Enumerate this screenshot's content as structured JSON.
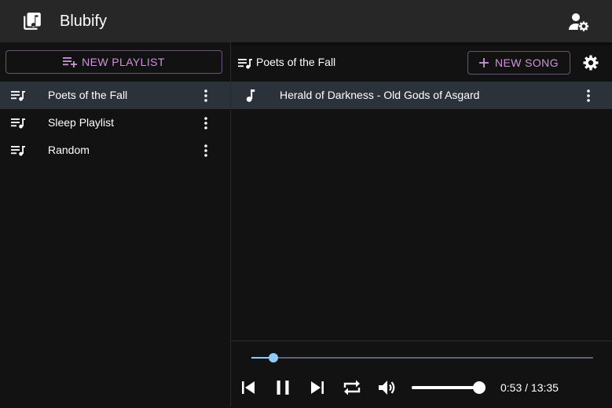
{
  "app": {
    "title": "Blubify"
  },
  "sidebar": {
    "new_playlist_label": "NEW PLAYLIST",
    "playlists": [
      {
        "label": "Poets of the Fall",
        "selected": true
      },
      {
        "label": "Sleep Playlist",
        "selected": false
      },
      {
        "label": "Random",
        "selected": false
      }
    ]
  },
  "main": {
    "playlist_title": "Poets of the Fall",
    "new_song_label": "NEW SONG",
    "songs": [
      {
        "label": "Herald of Darkness - Old Gods of Asgard",
        "selected": true
      }
    ]
  },
  "player": {
    "progress": 0.065,
    "volume": 0.98,
    "time_display": "0:53 / 13:35"
  },
  "icons": {
    "logo": "music-library-icon",
    "account": "account-settings-icon",
    "playlist": "playlist-music-icon",
    "add_playlist": "playlist-add-icon",
    "more": "more-vert-icon",
    "add": "plus-icon",
    "settings": "gear-icon",
    "song": "music-note-icon",
    "prev": "skip-previous-icon",
    "pause": "pause-icon",
    "next": "skip-next-icon",
    "repeat": "repeat-icon",
    "volume": "volume-up-icon"
  },
  "colors": {
    "accent": "#cf93d9",
    "selected_row": "#2c323a",
    "seek": "#90caf9",
    "appbar": "#272727",
    "background": "#121212"
  }
}
